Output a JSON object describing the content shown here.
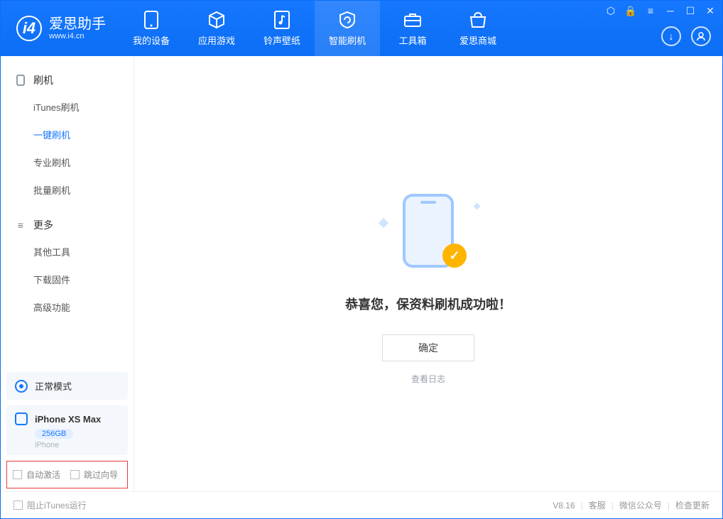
{
  "app": {
    "name": "爱思助手",
    "site": "www.i4.cn"
  },
  "nav": [
    {
      "label": "我的设备"
    },
    {
      "label": "应用游戏"
    },
    {
      "label": "铃声壁纸"
    },
    {
      "label": "智能刷机"
    },
    {
      "label": "工具箱"
    },
    {
      "label": "爱思商城"
    }
  ],
  "sidebar": {
    "group1": {
      "title": "刷机",
      "items": [
        "iTunes刷机",
        "一键刷机",
        "专业刷机",
        "批量刷机"
      ]
    },
    "group2": {
      "title": "更多",
      "items": [
        "其他工具",
        "下载固件",
        "高级功能"
      ]
    },
    "mode": "正常模式",
    "device": {
      "name": "iPhone XS Max",
      "capacity": "256GB",
      "type": "iPhone"
    },
    "checks": {
      "auto_activate": "自动激活",
      "skip_guide": "跳过向导"
    }
  },
  "main": {
    "success_text": "恭喜您，保资料刷机成功啦！",
    "ok_label": "确定",
    "log_label": "查看日志"
  },
  "footer": {
    "block_itunes": "阻止iTunes运行",
    "version": "V8.16",
    "links": [
      "客服",
      "微信公众号",
      "检查更新"
    ]
  }
}
